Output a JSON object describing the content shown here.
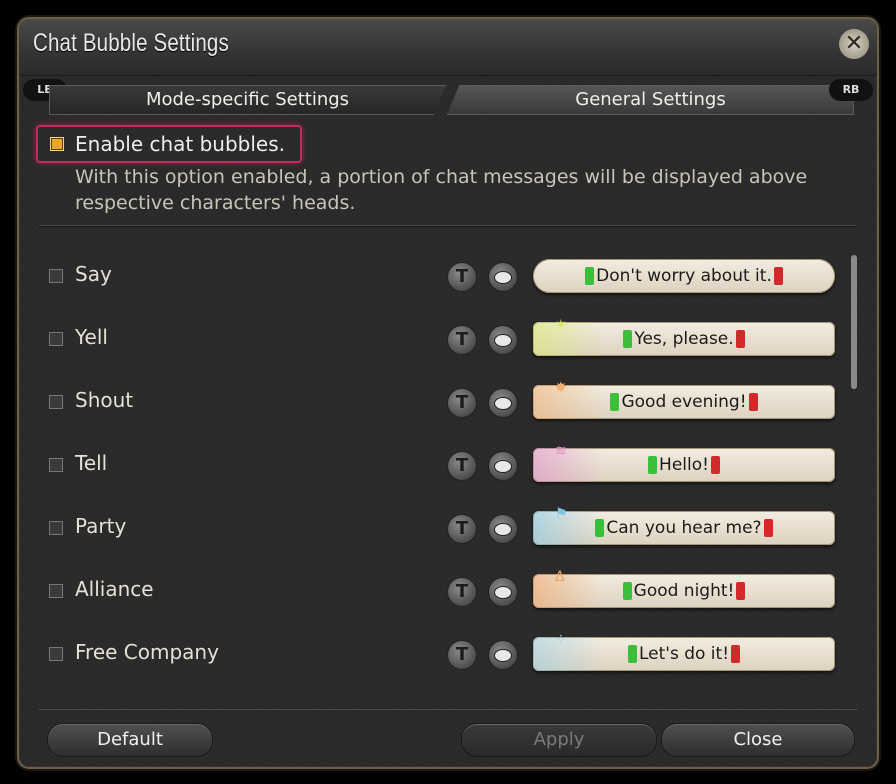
{
  "window": {
    "title": "Chat Bubble Settings"
  },
  "tabs": {
    "left_hint": "LB",
    "right_hint": "RB",
    "items": [
      {
        "label": "Mode-specific Settings"
      },
      {
        "label": "General Settings"
      }
    ]
  },
  "enable": {
    "label": "Enable chat bubbles.",
    "checked": true,
    "description": "With this option enabled, a portion of chat messages will be displayed above respective characters' heads."
  },
  "channels": [
    {
      "label": "Say",
      "preview": "Don't worry about it.",
      "accent": "#ffffff"
    },
    {
      "label": "Yell",
      "preview": "Yes, please.",
      "accent": "#d8e86a"
    },
    {
      "label": "Shout",
      "preview": "Good evening!",
      "accent": "#f0b070"
    },
    {
      "label": "Tell",
      "preview": "Hello!",
      "accent": "#e08ac8"
    },
    {
      "label": "Party",
      "preview": "Can you hear me?",
      "accent": "#7ec6e6"
    },
    {
      "label": "Alliance",
      "preview": "Good night!",
      "accent": "#f0a060"
    },
    {
      "label": "Free Company",
      "preview": "Let's do it!",
      "accent": "#9ad0e6"
    }
  ],
  "row_buttons": {
    "text_icon": "T"
  },
  "footer": {
    "default": "Default",
    "apply": "Apply",
    "close": "Close"
  },
  "colors": {
    "highlight": "#c2295d",
    "check_on": "#e8a628",
    "quote_open": "#3bbf3b",
    "quote_close": "#d02a2a"
  }
}
